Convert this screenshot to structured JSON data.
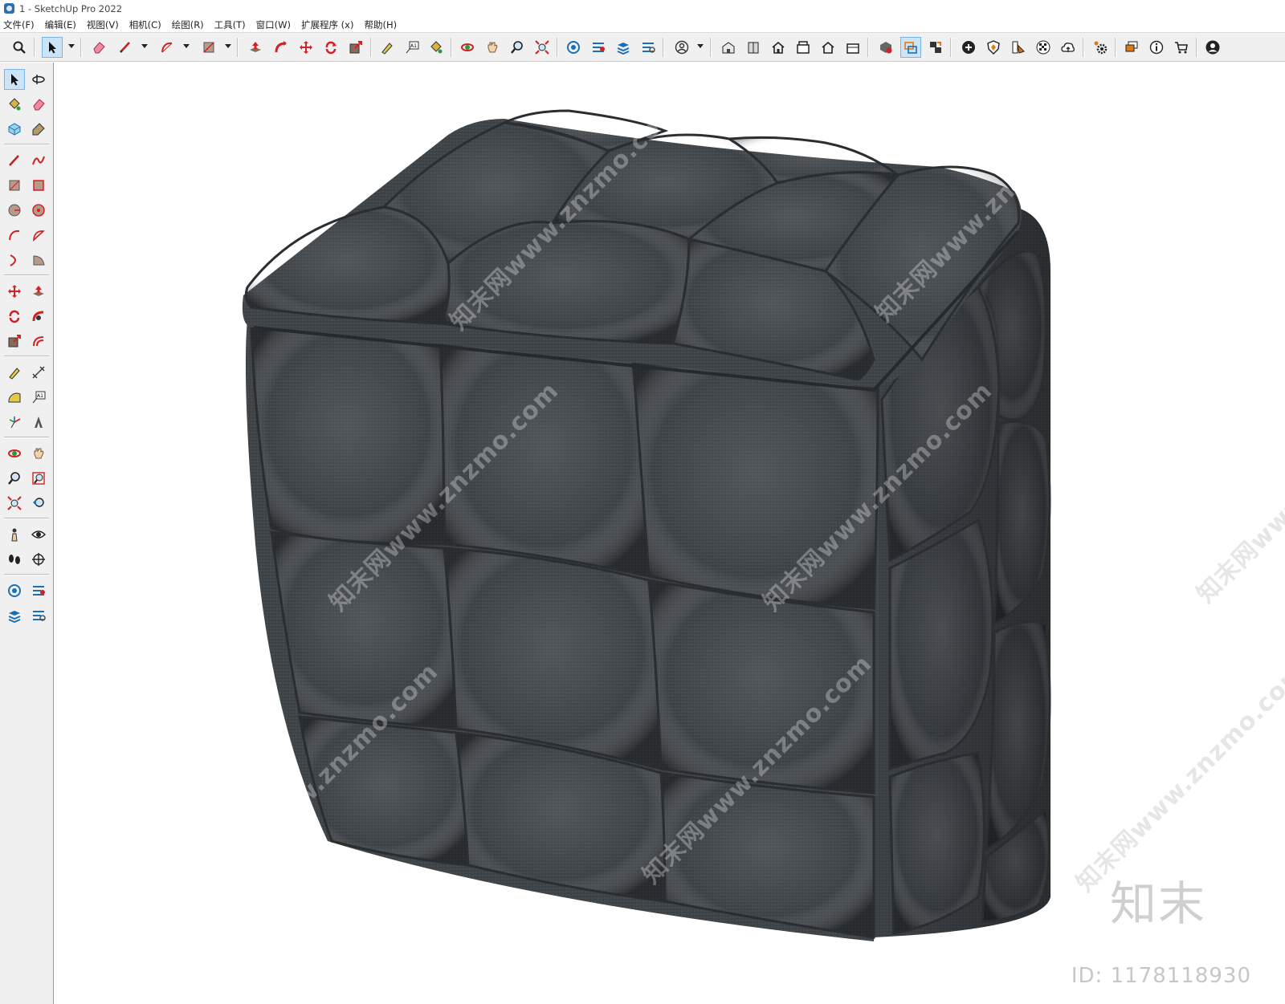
{
  "window": {
    "title": "1 - SketchUp Pro 2022",
    "icon": "sketchup-logo-icon"
  },
  "menu": {
    "items": [
      {
        "label": "文件(F)"
      },
      {
        "label": "编辑(E)"
      },
      {
        "label": "视图(V)"
      },
      {
        "label": "相机(C)"
      },
      {
        "label": "绘图(R)"
      },
      {
        "label": "工具(T)"
      },
      {
        "label": "窗口(W)"
      },
      {
        "label": "扩展程序 (x)"
      },
      {
        "label": "帮助(H)"
      }
    ]
  },
  "toolbar": {
    "active_tool": "select-tool",
    "tools": [
      "search-icon",
      "select-icon",
      "eraser-icon",
      "pencil-icon",
      "arc-icon",
      "rectangle-icon",
      "push-pull-icon",
      "follow-me-icon",
      "move-icon",
      "rotate-icon",
      "scale-icon",
      "tape-measure-icon",
      "text-icon",
      "paint-bucket-icon",
      "orbit-icon",
      "pan-icon",
      "zoom-icon",
      "zoom-extents-icon",
      "warehouse-icon",
      "extension-warehouse-icon",
      "layer-icon",
      "share-icon",
      "profile-icon",
      "iso-view-icon",
      "front-view-icon",
      "home-view-icon",
      "top-view-icon",
      "right-view-icon",
      "back-view-icon",
      "component-icon",
      "section-icon",
      "scenes-icon",
      "add-icon",
      "shield-icon",
      "materials-icon",
      "checker-icon",
      "cloud-icon",
      "settings-icon",
      "chat-icon",
      "info-icon",
      "cart-icon",
      "user-icon"
    ]
  },
  "left_toolbar": {
    "tools": [
      "select-icon",
      "orbit-icon",
      "paint-bucket-icon",
      "eraser-icon",
      "component-icon",
      "tag-icon",
      "pencil-icon",
      "freehand-icon",
      "rectangle-icon",
      "rotated-rectangle-icon",
      "circle-icon",
      "polygon-icon",
      "arc-icon",
      "pie-icon",
      "two-point-arc-icon",
      "three-point-arc-icon",
      "move-icon",
      "push-pull-icon",
      "rotate-icon",
      "follow-me-icon",
      "scale-icon",
      "offset-icon",
      "tape-measure-icon",
      "dimension-icon",
      "protractor-icon",
      "text-icon",
      "axes-icon",
      "3d-text-icon",
      "orbit-icon",
      "pan-icon",
      "zoom-icon",
      "zoom-window-icon",
      "zoom-extents-icon",
      "previous-view-icon",
      "position-camera-icon",
      "look-around-icon",
      "walk-icon",
      "section-plane-icon",
      "warehouse-icon",
      "extension-warehouse-icon",
      "layer-icon",
      "share-icon"
    ]
  },
  "viewport": {
    "model": "tufted-cube-ottoman",
    "fabric_color": "#3e4347",
    "watermark_text": "知末网www.znzmo.com",
    "logo_text": "知末",
    "id_text": "ID: 1178118930"
  },
  "colors": {
    "toolbar_bg": "#f0f0f0",
    "active_bg": "#cce4f7",
    "accent_red": "#d42020"
  }
}
